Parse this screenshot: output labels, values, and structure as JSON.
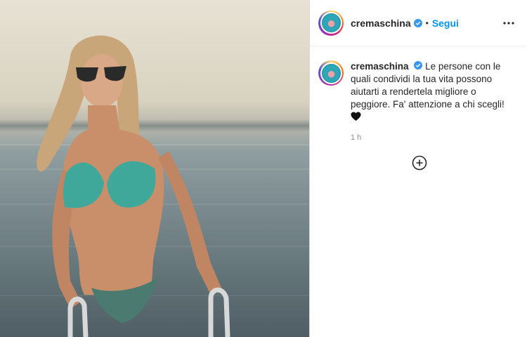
{
  "header": {
    "username": "cremaschina",
    "separator": "•",
    "follow_label": "Segui"
  },
  "caption": {
    "username": "cremaschina",
    "text": "Le persone con le quali condividi la tua vita possono aiutarti a rendertela migliore o peggiore. Fa' attenzione a chi scegli!",
    "time": "1 h"
  },
  "icons": {
    "verified": "verified-badge-icon",
    "more": "more-options-icon",
    "heart": "black-heart-emoji",
    "add": "plus-circle-icon"
  },
  "colors": {
    "accent": "#0095f6",
    "verified": "#3897f0",
    "text": "#262626",
    "muted": "#8e8e8e"
  }
}
